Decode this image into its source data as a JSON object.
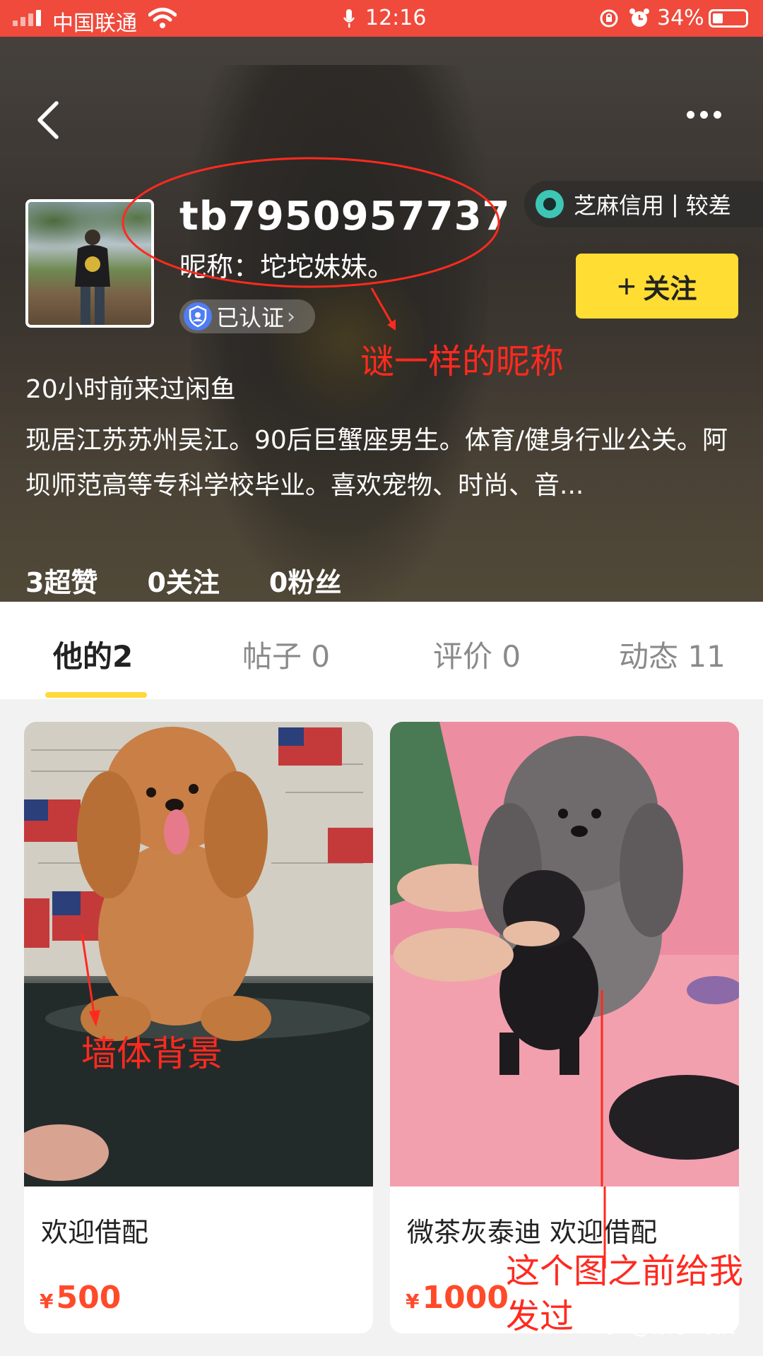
{
  "status_bar": {
    "carrier": "中国联通",
    "time": "12:16",
    "battery": "34%"
  },
  "profile": {
    "username": "tb7950957737",
    "nickname": "昵称：坨坨妹妹。",
    "verified_label": "已认证",
    "credit_label": "芝麻信用",
    "credit_level": "较差",
    "follow_label": "关注",
    "last_visit": "20小时前来过闲鱼",
    "bio": "现居江苏苏州吴江。90后巨蟹座男生。体育/健身行业公关。阿坝师范高等专科学校毕业。喜欢宠物、时尚、音...",
    "stats": {
      "likes": "3超赞",
      "following": "0关注",
      "followers": "0粉丝"
    }
  },
  "tabs": [
    {
      "label": "他的2"
    },
    {
      "label": "帖子 0"
    },
    {
      "label": "评价 0"
    },
    {
      "label": "动态 11"
    }
  ],
  "items": [
    {
      "title": "欢迎借配",
      "price_symbol": "¥",
      "price": "500"
    },
    {
      "title": "微茶灰泰迪    欢迎借配",
      "price_symbol": "¥",
      "price": "1000"
    }
  ],
  "annotations": {
    "nickname_note": "谜一样的昵称",
    "wall_note": "墙体背景",
    "sent_note_line1": "这个图之前给我",
    "sent_note_line2": "发过"
  },
  "watermark": "知乎 @猴子的猫",
  "colors": {
    "status_bar": "#ef4a3c",
    "follow_button": "#ffdd33",
    "tab_indicator": "#ffd83a",
    "price": "#ff4a2a",
    "annotation": "#ff2a1f"
  }
}
